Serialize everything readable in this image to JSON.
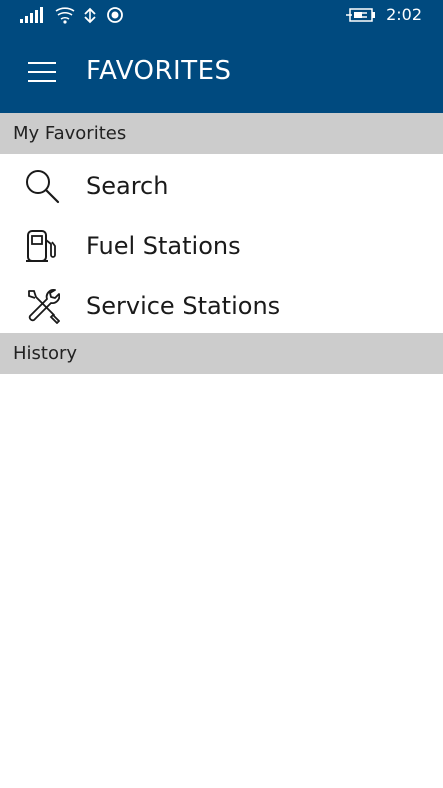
{
  "status_bar": {
    "time": "2:02",
    "icons": [
      "signal-bars-icon",
      "wifi-icon",
      "data-sync-icon",
      "record-icon",
      "battery-charging-icon"
    ]
  },
  "header": {
    "title": "FAVORITES",
    "menu_icon": "hamburger-menu-icon",
    "background": "#004a7f"
  },
  "sections": {
    "favorites": {
      "header": "My Favorites",
      "items": [
        {
          "label": "Search",
          "icon": "search-icon"
        },
        {
          "label": "Fuel Stations",
          "icon": "fuel-pump-icon"
        },
        {
          "label": "Service Stations",
          "icon": "wrench-screwdriver-icon"
        }
      ]
    },
    "history": {
      "header": "History"
    }
  },
  "colors": {
    "accent": "#004a7f",
    "section_header_bg": "#cccccc"
  }
}
